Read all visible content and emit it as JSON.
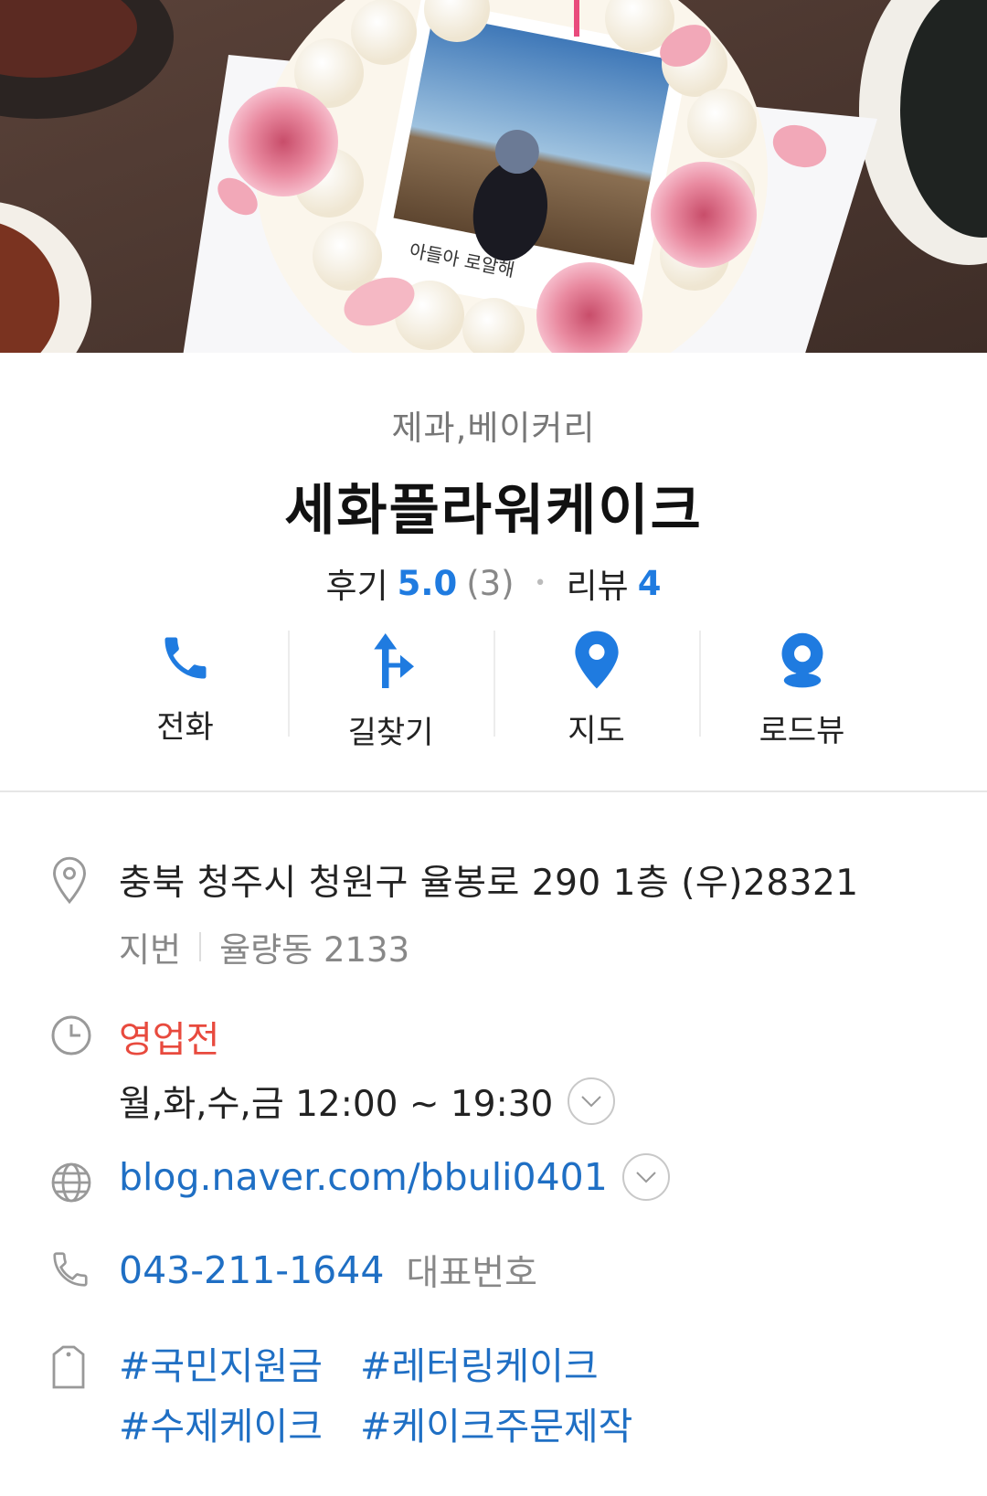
{
  "place": {
    "category": "제과,베이커리",
    "name": "세화플라워케이크",
    "review_label": "후기",
    "rating": "5.0",
    "rating_count": "(3)",
    "blog_review_label": "리뷰",
    "blog_review_count": "4"
  },
  "hero": {
    "cake_note": "아들아 로알해"
  },
  "actions": [
    {
      "label": "전화",
      "icon": "phone-icon"
    },
    {
      "label": "길찾기",
      "icon": "directions-icon"
    },
    {
      "label": "지도",
      "icon": "map-pin-icon"
    },
    {
      "label": "로드뷰",
      "icon": "roadview-icon"
    }
  ],
  "address": {
    "road": "충북 청주시 청원구 율봉로 290 1층 (우)28321",
    "jibun_label": "지번",
    "jibun": "율량동 2133"
  },
  "hours": {
    "status": "영업전",
    "schedule": "월,화,수,금 12:00 ~ 19:30"
  },
  "website": {
    "url": "blog.naver.com/bbuli0401"
  },
  "phone": {
    "number": "043-211-1644",
    "label": "대표번호"
  },
  "tags": [
    "#국민지원금",
    "#레터링케이크",
    "#수제케이크",
    "#케이크주문제작"
  ],
  "colors": {
    "accent_blue": "#1f7be0",
    "link_blue": "#1f6fc4",
    "status_red": "#e84a3e"
  }
}
